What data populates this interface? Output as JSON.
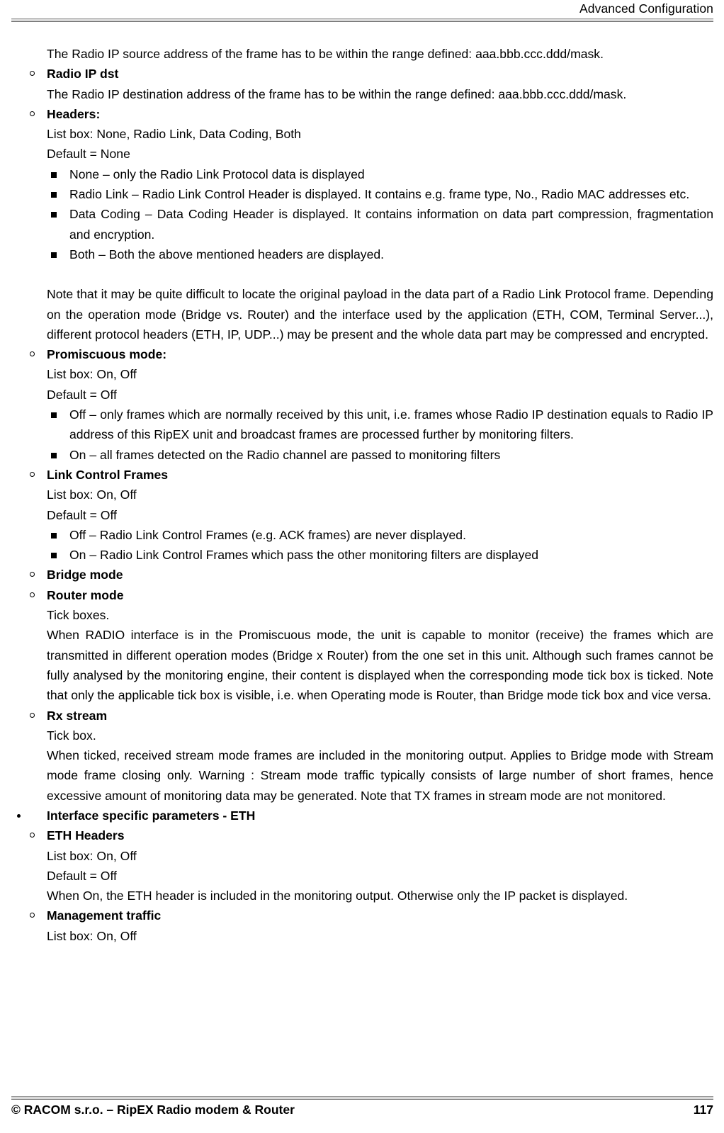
{
  "header": {
    "title": "Advanced Configuration"
  },
  "footer": {
    "copyright": "© RACOM s.r.o. – RipEX Radio modem & Router",
    "page_number": "117"
  },
  "body": {
    "p_radio_ip_src_desc": "The Radio IP source address of the frame has to be within the range defined: aaa.bbb.ccc.ddd/mask.",
    "item_radio_ip_dst": "Radio IP dst",
    "p_radio_ip_dst_desc": "The Radio IP destination address of the frame has to be within the range defined: aaa.bbb.ccc.ddd/mask.",
    "item_headers": "Headers:",
    "headers_listbox": "List box: None, Radio Link, Data Coding, Both",
    "headers_default": "Default = None",
    "headers_opt_none": "None – only the Radio Link Protocol data is displayed",
    "headers_opt_radio_link": "Radio Link – Radio Link Control Header is displayed. It contains e.g. frame type, No., Radio MAC addresses etc.",
    "headers_opt_data_coding": "Data Coding – Data Coding Header is displayed. It contains information on data part compression, fragmentation and encryption.",
    "headers_opt_both": "Both – Both the above mentioned headers are displayed.",
    "p_note_payload": "Note that it may be quite difficult to locate the original payload in the data part of a Radio Link Protocol frame. Depending on the operation mode (Bridge vs. Router) and the interface used by the application (ETH, COM, Terminal Server...), different protocol headers (ETH, IP, UDP...) may be present and the whole data part may be compressed and encrypted.",
    "item_promiscuous": "Promiscuous mode:",
    "promiscuous_listbox": "List box: On, Off",
    "promiscuous_default": "Default = Off",
    "promiscuous_opt_off": "Off – only frames which are normally received by this unit, i.e. frames whose Radio IP destination equals to Radio IP address of this RipEX unit and broadcast frames are processed further by monitoring filters.",
    "promiscuous_opt_on": "On – all frames detected on the Radio channel are passed to monitoring filters",
    "item_link_control_frames": "Link Control Frames",
    "lcf_listbox": "List box: On, Off",
    "lcf_default": "Default = Off",
    "lcf_opt_off": "Off – Radio Link Control Frames (e.g. ACK frames) are never displayed.",
    "lcf_opt_on": "On – Radio Link Control Frames which pass the other monitoring filters are displayed",
    "item_bridge_mode": "Bridge mode",
    "item_router_mode": "Router mode",
    "modes_tick": "Tick boxes.",
    "modes_desc": "When RADIO interface is in the Promiscuous mode, the unit is capable to monitor (receive) the frames which are transmitted in different operation modes (Bridge x Router) from the one set in this unit. Although such frames cannot be fully analysed by the monitoring engine, their content is displayed when the corresponding mode tick box is ticked. Note that only the applicable tick box is visible, i.e. when Operating mode is Router, than Bridge mode tick box and vice versa.",
    "item_rx_stream": "Rx stream",
    "rx_stream_tick": "Tick box.",
    "rx_stream_desc": "When ticked, received stream mode frames are included in the monitoring output. Applies to Bridge mode with Stream mode frame closing only. Warning : Stream mode traffic typically consists of large number of short frames, hence excessive amount of monitoring data may be generated. Note that TX frames in stream mode are not monitored.",
    "item_interface_eth": "Interface specific parameters - ETH",
    "item_eth_headers": "ETH Headers",
    "eth_headers_listbox": "List box: On, Off",
    "eth_headers_default": "Default = Off",
    "eth_headers_desc": "When On, the ETH header is included in the monitoring output. Otherwise only the IP packet is displayed.",
    "item_management_traffic": "Management traffic",
    "management_listbox": "List box: On, Off"
  }
}
